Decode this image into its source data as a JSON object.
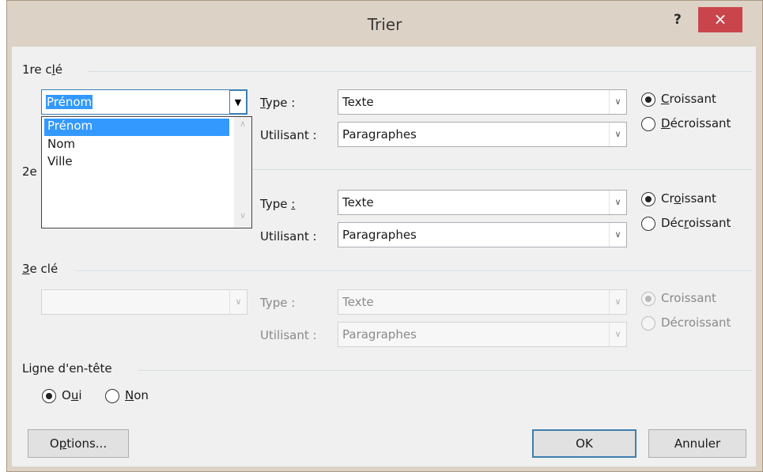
{
  "window": {
    "title": "Trier",
    "help": "?",
    "close": "×"
  },
  "key1": {
    "label_pre": "1re c",
    "label_u": "l",
    "label_post": "é",
    "field_value": "Prénom",
    "type_label_u": "T",
    "type_label_post": "ype :",
    "type_value": "Texte",
    "using_label": "Utilisant :",
    "using_value": "Paragraphes",
    "asc_u": "C",
    "asc_post": "roissant",
    "desc_u": "D",
    "desc_post": "écroissant",
    "order": "asc"
  },
  "dropdown": {
    "items": [
      "Prénom",
      "Nom",
      "Ville"
    ],
    "selected_index": 0
  },
  "key2": {
    "label_pre": "2e",
    "type_label_pre": "Type ",
    "type_label_u": ":",
    "type_value": "Texte",
    "using_label": "Utilisant :",
    "using_value": "Paragraphes",
    "asc_pre": "Cr",
    "asc_u": "o",
    "asc_post": "issant",
    "desc_pre": "Déc",
    "desc_u": "r",
    "desc_post": "oissant",
    "order": "asc"
  },
  "key3": {
    "label_u": "3",
    "label_post": "e clé",
    "field_value": "",
    "type_label": "Type :",
    "type_value": "Texte",
    "using_label": "Utilisant :",
    "using_value": "Paragraphes",
    "asc": "Croissant",
    "desc": "Décroissant",
    "order": "asc"
  },
  "header": {
    "label": "Ligne d'en-tête",
    "yes_pre": "O",
    "yes_u": "u",
    "yes_post": "i",
    "no_u": "N",
    "no_post": "on",
    "selected": "yes"
  },
  "buttons": {
    "options_pre": "O",
    "options_u": "p",
    "options_post": "tions...",
    "ok": "OK",
    "cancel": "Annuler"
  },
  "colors": {
    "accent": "#3399ff",
    "close": "#c9454b",
    "frame": "#dcd2c6",
    "client": "#f0f0f0"
  }
}
